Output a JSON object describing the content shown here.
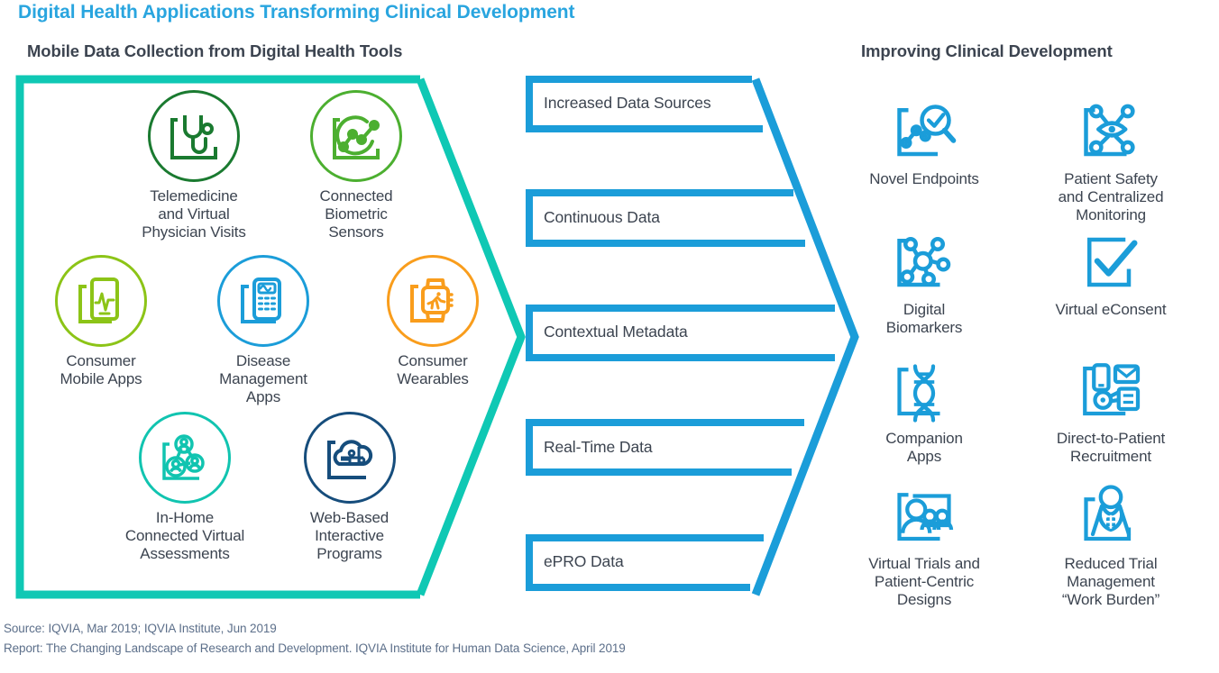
{
  "title": "Digital Health Applications Transforming Clinical Development",
  "sections": {
    "left_title": "Mobile Data Collection from Digital Health Tools",
    "right_title": "Improving Clinical Development"
  },
  "colors": {
    "title_blue": "#29a5df",
    "accent_blue": "#1b9dd9",
    "teal": "#0fc8b4",
    "teal_icon": "#11c4b0",
    "navy": "#164d7c",
    "dark_green": "#1a7a30",
    "green": "#4caf30",
    "lime": "#8cc417",
    "orange": "#f99d1c",
    "text": "#3c4450",
    "footer_text": "#5c6f8a"
  },
  "left_items": [
    {
      "label": "Telemedicine\nand Virtual\nPhysician Visits",
      "icon": "stethoscope-icon",
      "color": "#1a7a30"
    },
    {
      "label": "Connected\nBiometric\nSensors",
      "icon": "biometric-chart-icon",
      "color": "#4caf30"
    },
    {
      "label": "Consumer\nMobile Apps",
      "icon": "mobile-vitals-icon",
      "color": "#8cc417"
    },
    {
      "label": "Disease\nManagement\nApps",
      "icon": "calculator-device-icon",
      "color": "#1b9dd9"
    },
    {
      "label": "Consumer\nWearables",
      "icon": "smartwatch-runner-icon",
      "color": "#f99d1c"
    },
    {
      "label": "In-Home\nConnected Virtual\nAssessments",
      "icon": "connected-people-icon",
      "color": "#11c4b0"
    },
    {
      "label": "Web-Based\nInteractive\nPrograms",
      "icon": "cloud-network-icon",
      "color": "#164d7c"
    }
  ],
  "middle_bars": [
    {
      "label": "Increased Data Sources"
    },
    {
      "label": "Continuous Data"
    },
    {
      "label": "Contextual Metadata"
    },
    {
      "label": "Real-Time Data"
    },
    {
      "label": "ePRO Data"
    }
  ],
  "right_items": [
    {
      "label": "Novel Endpoints",
      "icon": "magnifier-chart-icon"
    },
    {
      "label": "Patient Safety\nand Centralized\nMonitoring",
      "icon": "eye-network-icon"
    },
    {
      "label": "Digital\nBiomarkers",
      "icon": "molecule-network-icon"
    },
    {
      "label": "Virtual eConsent",
      "icon": "checkmark-document-icon"
    },
    {
      "label": "Companion\nApps",
      "icon": "dna-helix-icon"
    },
    {
      "label": "Direct-to-Patient\nRecruitment",
      "icon": "outreach-devices-icon"
    },
    {
      "label": "Virtual Trials and\nPatient-Centric\nDesigns",
      "icon": "virtual-meeting-icon"
    },
    {
      "label": "Reduced Trial\nManagement\n“Work Burden”",
      "icon": "clinician-icon"
    }
  ],
  "footer": {
    "line1": "Source: IQVIA, Mar 2019; IQVIA Institute, Jun 2019",
    "line2": "Report: The Changing Landscape of Research and Development. IQVIA Institute for Human Data Science, April 2019"
  }
}
